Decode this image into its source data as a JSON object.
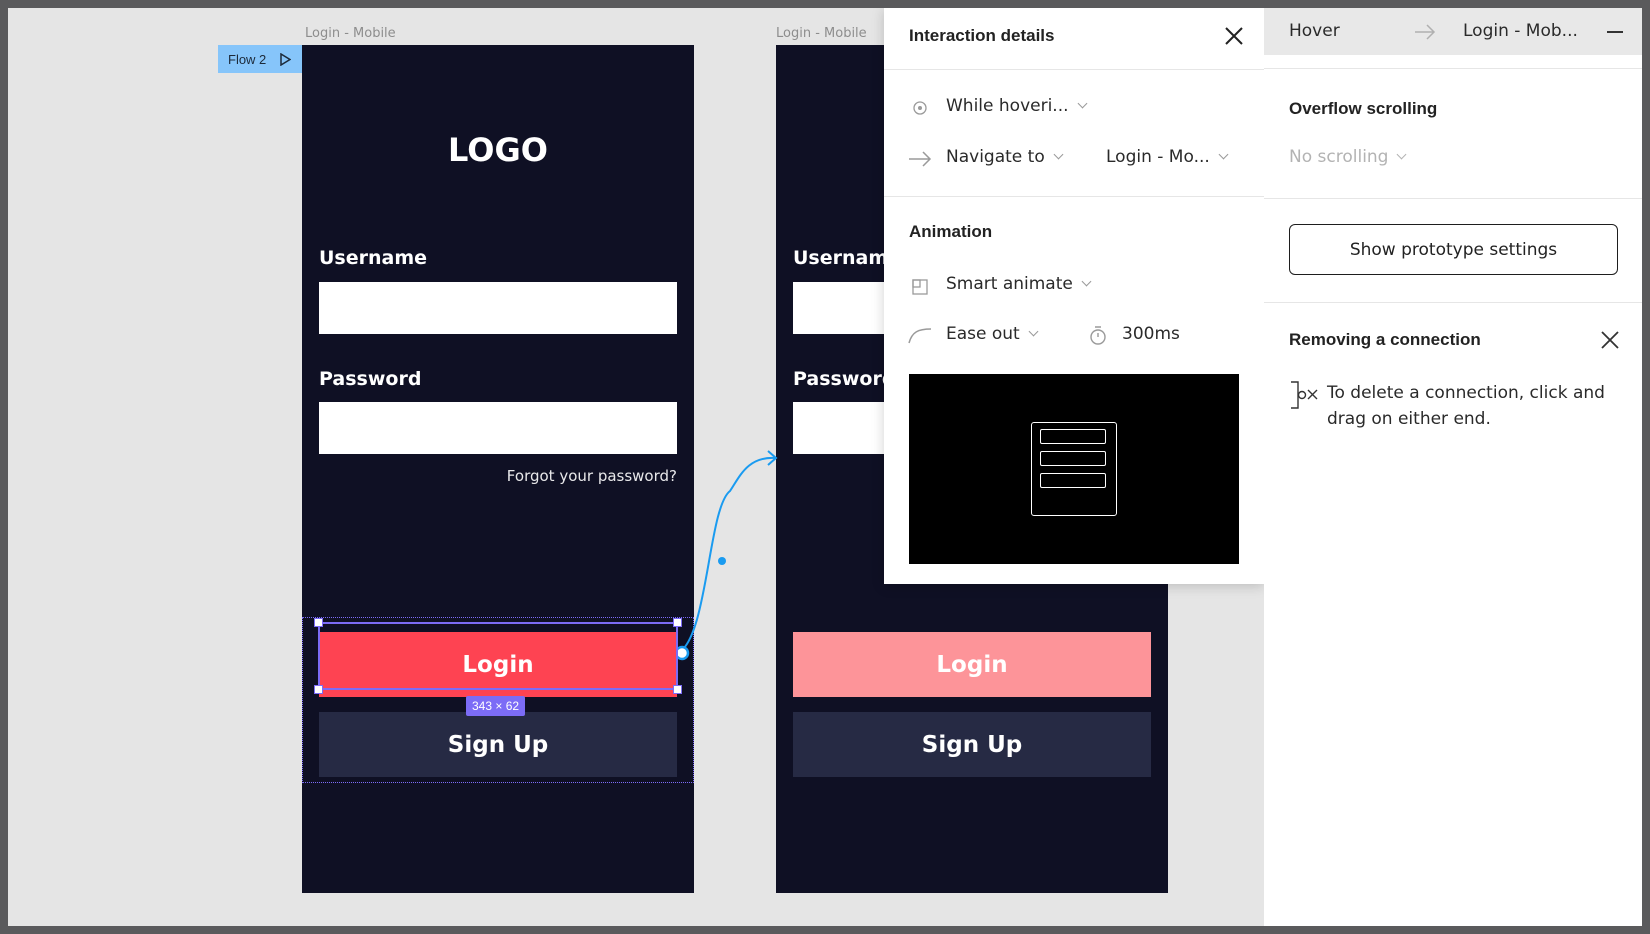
{
  "canvas": {
    "frame_label_1": "Login - Mobile",
    "frame_label_2": "Login - Mobile",
    "flow_tag": "Flow 2",
    "selection_dims": "343 × 62"
  },
  "screen1": {
    "logo": "LOGO",
    "username_label": "Username",
    "password_label": "Password",
    "forgot": "Forgot your password?",
    "login_button": "Login",
    "signup_button": "Sign Up"
  },
  "screen2": {
    "username_label": "Username",
    "password_label": "Password",
    "login_button": "Login",
    "signup_button": "Sign Up"
  },
  "interaction": {
    "title": "Interaction details",
    "trigger": "While hoveri...",
    "action": "Navigate to",
    "destination": "Login - Mo...",
    "animation_title": "Animation",
    "animation_type": "Smart animate",
    "easing": "Ease out",
    "duration": "300ms"
  },
  "panel": {
    "head_trigger": "Hover",
    "head_destination": "Login - Mob...",
    "overflow_title": "Overflow scrolling",
    "overflow_value": "No scrolling",
    "proto_button": "Show prototype settings",
    "removing_title": "Removing a connection",
    "removing_hint": "To delete a connection, click and drag on either end."
  },
  "colors": {
    "accent": "#7c6cf6",
    "login_red": "#fe4352",
    "login_dim": "#fd9499",
    "phone_bg": "#0f1024",
    "connector": "#1a9bf0"
  }
}
